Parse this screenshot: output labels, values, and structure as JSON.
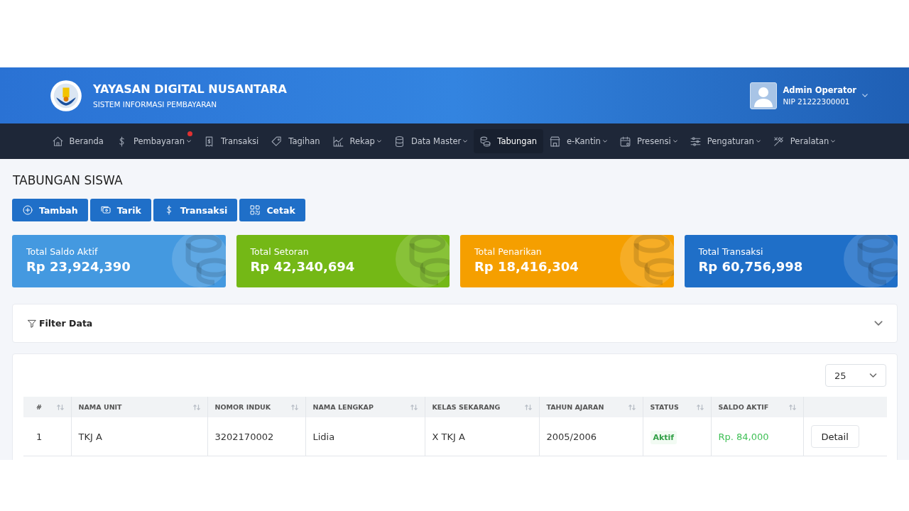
{
  "header": {
    "title": "YAYASAN DIGITAL NUSANTARA",
    "subtitle": "SISTEM INFORMASI PEMBAYARAN",
    "user": {
      "name": "Admin Operator",
      "nip": "NIP 21222300001"
    }
  },
  "nav": [
    {
      "label": "Beranda",
      "dropdown": false,
      "selected": false,
      "badge": false
    },
    {
      "label": "Pembayaran",
      "dropdown": true,
      "selected": false,
      "badge": true
    },
    {
      "label": "Transaksi",
      "dropdown": false,
      "selected": false,
      "badge": false
    },
    {
      "label": "Tagihan",
      "dropdown": false,
      "selected": false,
      "badge": false
    },
    {
      "label": "Rekap",
      "dropdown": true,
      "selected": false,
      "badge": false
    },
    {
      "label": "Data Master",
      "dropdown": true,
      "selected": false,
      "badge": false
    },
    {
      "label": "Tabungan",
      "dropdown": false,
      "selected": true,
      "badge": false
    },
    {
      "label": "e-Kantin",
      "dropdown": true,
      "selected": false,
      "badge": false
    },
    {
      "label": "Presensi",
      "dropdown": true,
      "selected": false,
      "badge": false
    },
    {
      "label": "Pengaturan",
      "dropdown": true,
      "selected": false,
      "badge": false
    },
    {
      "label": "Peralatan",
      "dropdown": true,
      "selected": false,
      "badge": false
    }
  ],
  "page_title": "TABUNGAN SISWA",
  "actions": [
    "Tambah",
    "Tarik",
    "Transaksi",
    "Cetak"
  ],
  "stats": [
    {
      "label": "Total Saldo Aktif",
      "value": "Rp 23,924,390",
      "color": "#4499e0"
    },
    {
      "label": "Total Setoran",
      "value": "Rp 42,340,694",
      "color": "#74b816"
    },
    {
      "label": "Total Penarikan",
      "value": "Rp 18,416,304",
      "color": "#f59f00"
    },
    {
      "label": "Total Transaksi",
      "value": "Rp 60,756,998",
      "color": "#1f6fc8"
    }
  ],
  "filter": {
    "title": "Filter Data",
    "expanded": false
  },
  "table": {
    "page_size": "25",
    "columns": [
      "#",
      "NAMA UNIT",
      "NOMOR INDUK",
      "NAMA LENGKAP",
      "KELAS SEKARANG",
      "TAHUN AJARAN",
      "STATUS",
      "SALDO AKTIF",
      ""
    ],
    "rows": [
      {
        "no": "1",
        "unit": "TKJ A",
        "nomor_induk": "3202170002",
        "nama": "Lidia",
        "kelas": "X TKJ A",
        "tahun": "2005/2006",
        "status": {
          "label": "Aktif",
          "kind": "active"
        },
        "saldo": "Rp. 84,000",
        "action": "Detail"
      }
    ]
  }
}
